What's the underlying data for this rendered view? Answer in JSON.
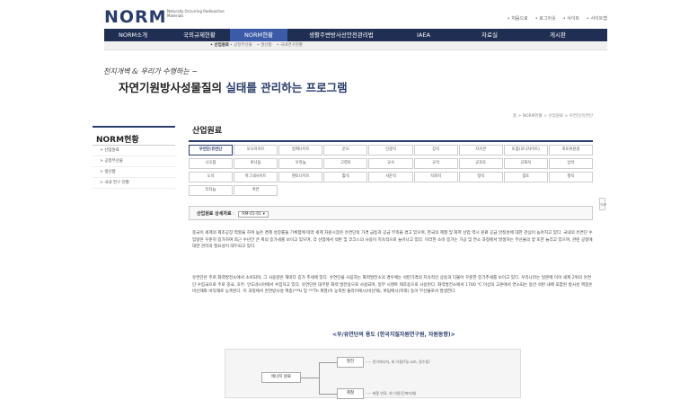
{
  "header": {
    "logo_text": "NORM",
    "logo_sub": "Naturally Occurring Radioactive Materials",
    "util_links": [
      "• 처음으로",
      "• 로그아웃",
      "• 사이트",
      "• 사이트맵"
    ]
  },
  "gnb": {
    "items": [
      "NORM소개",
      "국외규제현황",
      "NORM현황",
      "생활주변방사선안전관리법",
      "IAEA",
      "자료실",
      "게시판"
    ]
  },
  "sub_gnb": {
    "items": [
      "• 산업원료",
      "• 공정부산물",
      "• 생산품",
      "• 국내연구현황"
    ]
  },
  "hero": {
    "script": "천지개벽 & 우리가 수행하는 ~",
    "title_prefix": "자연기원방사성물질의 ",
    "title_highlight": "실태를 관리하는 프로그램"
  },
  "lnb": {
    "title": "NORM현황",
    "items": [
      "> 산업원료",
      "> 공정부산물",
      "> 생산품",
      "> 국내 연구 현황"
    ]
  },
  "content": {
    "breadcrumb": "홈 > NORM현황 > 산업원료 > 우연단/유연단",
    "title": "산업원료",
    "tabs": [
      [
        "우연단/유연단",
        "모나자이트",
        "일메나이트",
        "운모",
        "인광석",
        "장석",
        "지르콘",
        "토륨(모나자이트)",
        "희토류원광"
      ],
      [
        "니오븀",
        "바나듐",
        "우라늄",
        "고령토",
        "규사",
        "규석",
        "규조토",
        "규회석",
        "납석"
      ],
      [
        "도석",
        "마그네사이트",
        "벤토나이트",
        "활석",
        "사문석",
        "석회석",
        "형석",
        "점토",
        "질석"
      ],
      [
        "티타늄",
        "흑연"
      ]
    ],
    "detail_label": "산업원료 상세자료",
    "detail_select": "RM-01-01",
    "para1": "중국이 세계의 제조공장 역할을 하며 높은 경제 성장률을 기록함에 따라 세계 자원시장은 유연단의 가격 급등과 공급 부족을 겪고 있으며, 한국의 제철 및 화학 산업 역시 원료 공급 안정성에 대한 관심이 높아지고 있다. 국내의 유연단 수입량은 꾸준히 증가하여 최근 수년간 큰 폭의 증가세를 보이고 있으며, 각 산업에서 석탄 및 코크스의 사용이 지속적으로 늘어나고 있다. 이러한 소비 증가는 가공 및 연소 과정에서 발생하는 부산물의 양 또한 늘리고 있으며, 관련 공정에 대한 관리의 필요성이 대두되고 있다.",
    "para2": "유연단은 주로 화력발전소에서 소비되며, 그 사용량은 해마다 증가 추세에 있다. 유연단을 사용하는 화력발전소의 경우에는 석탄가격의 지속적인 상승과 더불어 꾸준한 증가추세를 보이고 있다. 우리나라는 일본에 이어 세계 2위의 유연단 수입국으로 주로 중국, 호주, 인도네시아에서 수입하고 있다. 유연단은 대부분 화력 발전용으로 사용되며, 일부 시멘트 제조용으로 사용된다. 화력발전소에서 1700 ℃ 이상의 고온에서 연소되는 동안 석탄 내에 포함된 방사성 핵종은 비산재와 바닥재로 농축된다. 이 과정에서 천연방사성 핵종(²³⁸U 및 ²³²Th 계열)이 농축된 플라이애시(비산재), 바텀애시(저회) 등이 부산물로서 발생한다.",
    "diagram_title": "<우/유연단의 용도 (한국지질자원연구원, 자원동향)>",
    "diagram": {
      "left_box": "에너지 원료",
      "top_box": "발전",
      "bottom_box": "제철",
      "top_note": "····· 전기에너지, 회 이용(Fly ash, 정수용)",
      "bottom_note": "····· 제철 연료, 회 이용(건축자재)"
    },
    "top_button": "TOP"
  }
}
